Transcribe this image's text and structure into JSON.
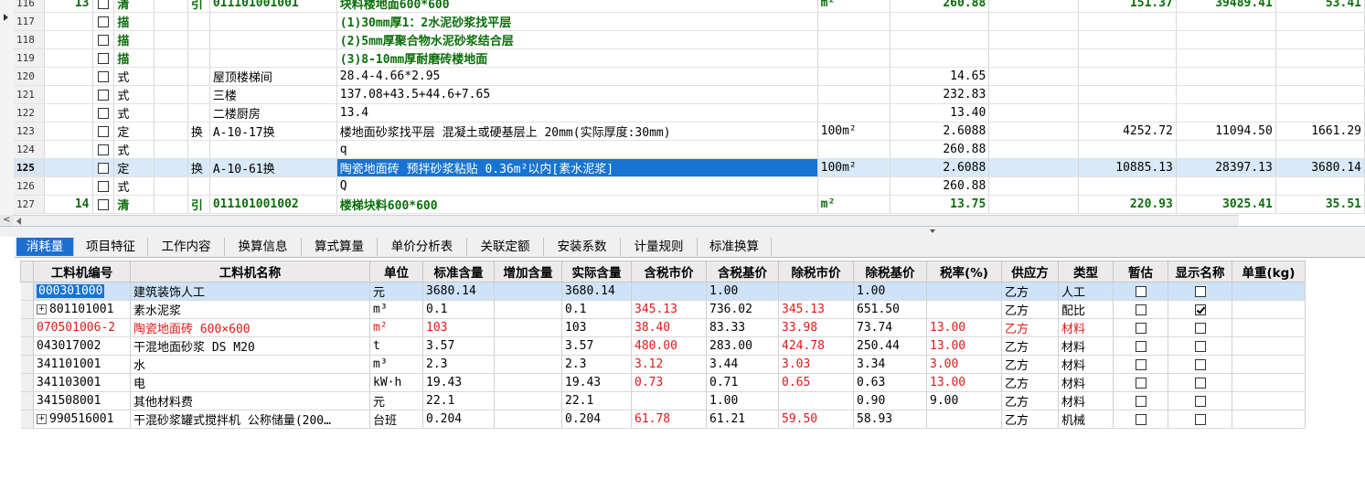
{
  "upper_table": {
    "rows": [
      {
        "rn": "116",
        "seq": "13",
        "type": "清",
        "flag": "引",
        "code": "011101001001",
        "name": "块料楼地面600*600",
        "unit": "m²",
        "qty": "260.88",
        "c9": "",
        "c10": "151.37",
        "c11": "39489.41",
        "c12": "53.41",
        "style": "green"
      },
      {
        "rn": "117",
        "seq": "",
        "type": "描",
        "flag": "",
        "code": "",
        "name": "(1)30mm厚1：2水泥砂浆找平层",
        "unit": "",
        "qty": "",
        "c9": "",
        "c10": "",
        "c11": "",
        "c12": "",
        "style": "green"
      },
      {
        "rn": "118",
        "seq": "",
        "type": "描",
        "flag": "",
        "code": "",
        "name": "(2)5mm厚聚合物水泥砂浆结合层",
        "unit": "",
        "qty": "",
        "c9": "",
        "c10": "",
        "c11": "",
        "c12": "",
        "style": "green"
      },
      {
        "rn": "119",
        "seq": "",
        "type": "描",
        "flag": "",
        "code": "",
        "name": "(3)8-10mm厚耐磨砖楼地面",
        "unit": "",
        "qty": "",
        "c9": "",
        "c10": "",
        "c11": "",
        "c12": "",
        "style": "green"
      },
      {
        "rn": "120",
        "seq": "",
        "type": "式",
        "flag": "",
        "code": "屋顶楼梯间",
        "name": "28.4-4.66*2.95",
        "unit": "",
        "qty": "14.65",
        "c9": "",
        "c10": "",
        "c11": "",
        "c12": "",
        "style": ""
      },
      {
        "rn": "121",
        "seq": "",
        "type": "式",
        "flag": "",
        "code": "三楼",
        "name": "137.08+43.5+44.6+7.65",
        "unit": "",
        "qty": "232.83",
        "c9": "",
        "c10": "",
        "c11": "",
        "c12": "",
        "style": ""
      },
      {
        "rn": "122",
        "seq": "",
        "type": "式",
        "flag": "",
        "code": "二楼厨房",
        "name": "13.4",
        "unit": "",
        "qty": "13.40",
        "c9": "",
        "c10": "",
        "c11": "",
        "c12": "",
        "style": ""
      },
      {
        "rn": "123",
        "seq": "",
        "type": "定",
        "flag": "换",
        "code": "A-10-17换",
        "name": "楼地面砂浆找平层 混凝土或硬基层上 20mm(实际厚度:30mm)",
        "unit": "100m²",
        "qty": "2.6088",
        "c9": "",
        "c10": "4252.72",
        "c11": "11094.50",
        "c12": "1661.29",
        "style": ""
      },
      {
        "rn": "124",
        "seq": "",
        "type": "式",
        "flag": "",
        "code": "",
        "name": "q",
        "unit": "",
        "qty": "260.88",
        "c9": "",
        "c10": "",
        "c11": "",
        "c12": "",
        "style": ""
      },
      {
        "rn": "125",
        "seq": "",
        "type": "定",
        "flag": "换",
        "code": "A-10-61换",
        "name": "陶瓷地面砖 预拌砂浆粘贴 0.36m²以内[素水泥浆]",
        "unit": "100m²",
        "qty": "2.6088",
        "c9": "",
        "c10": "10885.13",
        "c11": "28397.13",
        "c12": "3680.14",
        "style": "selected"
      },
      {
        "rn": "126",
        "seq": "",
        "type": "式",
        "flag": "",
        "code": "",
        "name": "Q",
        "unit": "",
        "qty": "260.88",
        "c9": "",
        "c10": "",
        "c11": "",
        "c12": "",
        "style": ""
      },
      {
        "rn": "127",
        "seq": "14",
        "type": "清",
        "flag": "引",
        "code": "011101001002",
        "name": "楼梯块料600*600",
        "unit": "m²",
        "qty": "13.75",
        "c9": "",
        "c10": "220.93",
        "c11": "3025.41",
        "c12": "35.51",
        "style": "green"
      }
    ]
  },
  "tabs": [
    "消耗量",
    "项目特征",
    "工作内容",
    "换算信息",
    "算式算量",
    "单价分析表",
    "关联定额",
    "安装系数",
    "计量规则",
    "标准换算"
  ],
  "active_tab": 0,
  "resource_table": {
    "headers": [
      "工料机编号",
      "工料机名称",
      "单位",
      "标准含量",
      "增加含量",
      "实际含量",
      "含税市价",
      "含税基价",
      "除税市价",
      "除税基价",
      "税率(%)",
      "供应方",
      "类型",
      "暂估",
      "显示名称",
      "单重(kg)"
    ],
    "rows": [
      {
        "code": "000301000",
        "name": "建筑装饰人工",
        "unit": "元",
        "std": "3680.14",
        "add": "",
        "act": "3680.14",
        "tax_mkt": "",
        "tax_base": "1.00",
        "ex_mkt": "",
        "ex_base": "1.00",
        "rate": "",
        "supplier": "乙方",
        "kind": "人工",
        "est": false,
        "show": false,
        "expand": false,
        "red_row": false,
        "red_prices": false,
        "selected": true
      },
      {
        "code": "801101001",
        "name": "素水泥浆",
        "unit": "m³",
        "std": "0.1",
        "add": "",
        "act": "0.1",
        "tax_mkt": "345.13",
        "tax_base": "736.02",
        "ex_mkt": "345.13",
        "ex_base": "651.50",
        "rate": "",
        "supplier": "乙方",
        "kind": "配比",
        "est": false,
        "show": true,
        "expand": true,
        "red_row": false,
        "red_prices": true,
        "selected": false
      },
      {
        "code": "070501006-2",
        "name": "陶瓷地面砖 600×600",
        "unit": "m²",
        "std": "103",
        "add": "",
        "act": "103",
        "tax_mkt": "38.40",
        "tax_base": "83.33",
        "ex_mkt": "33.98",
        "ex_base": "73.74",
        "rate": "13.00",
        "supplier": "乙方",
        "kind": "材料",
        "est": false,
        "show": false,
        "expand": false,
        "red_row": true,
        "red_prices": true,
        "selected": false
      },
      {
        "code": "043017002",
        "name": "干混地面砂浆 DS M20",
        "unit": "t",
        "std": "3.57",
        "add": "",
        "act": "3.57",
        "tax_mkt": "480.00",
        "tax_base": "283.00",
        "ex_mkt": "424.78",
        "ex_base": "250.44",
        "rate": "13.00",
        "supplier": "乙方",
        "kind": "材料",
        "est": false,
        "show": false,
        "expand": false,
        "red_row": false,
        "red_prices": true,
        "selected": false
      },
      {
        "code": "341101001",
        "name": "水",
        "unit": "m³",
        "std": "2.3",
        "add": "",
        "act": "2.3",
        "tax_mkt": "3.12",
        "tax_base": "3.44",
        "ex_mkt": "3.03",
        "ex_base": "3.34",
        "rate": "3.00",
        "supplier": "乙方",
        "kind": "材料",
        "est": false,
        "show": false,
        "expand": false,
        "red_row": false,
        "red_prices": true,
        "selected": false
      },
      {
        "code": "341103001",
        "name": "电",
        "unit": "kW·h",
        "std": "19.43",
        "add": "",
        "act": "19.43",
        "tax_mkt": "0.73",
        "tax_base": "0.71",
        "ex_mkt": "0.65",
        "ex_base": "0.63",
        "rate": "13.00",
        "supplier": "乙方",
        "kind": "材料",
        "est": false,
        "show": false,
        "expand": false,
        "red_row": false,
        "red_prices": true,
        "selected": false
      },
      {
        "code": "341508001",
        "name": "其他材料费",
        "unit": "元",
        "std": "22.1",
        "add": "",
        "act": "22.1",
        "tax_mkt": "",
        "tax_base": "1.00",
        "ex_mkt": "",
        "ex_base": "0.90",
        "rate": "9.00",
        "supplier": "乙方",
        "kind": "材料",
        "est": false,
        "show": false,
        "expand": false,
        "red_row": false,
        "red_prices": false,
        "selected": false
      },
      {
        "code": "990516001",
        "name": "干混砂浆罐式搅拌机 公称储量(200…",
        "unit": "台班",
        "std": "0.204",
        "add": "",
        "act": "0.204",
        "tax_mkt": "61.78",
        "tax_base": "61.21",
        "ex_mkt": "59.50",
        "ex_base": "58.93",
        "rate": "",
        "supplier": "乙方",
        "kind": "机械",
        "est": false,
        "show": false,
        "expand": true,
        "red_row": false,
        "red_prices": true,
        "selected": false
      }
    ]
  },
  "colors": {
    "accent": "#1c6fd1",
    "selection": "#1874d2",
    "green": "#0b6e0b",
    "red": "#e01818"
  },
  "icons": [
    "expand-icon",
    "checkbox-icon",
    "scroll-left-icon",
    "splitter-grip-icon"
  ]
}
